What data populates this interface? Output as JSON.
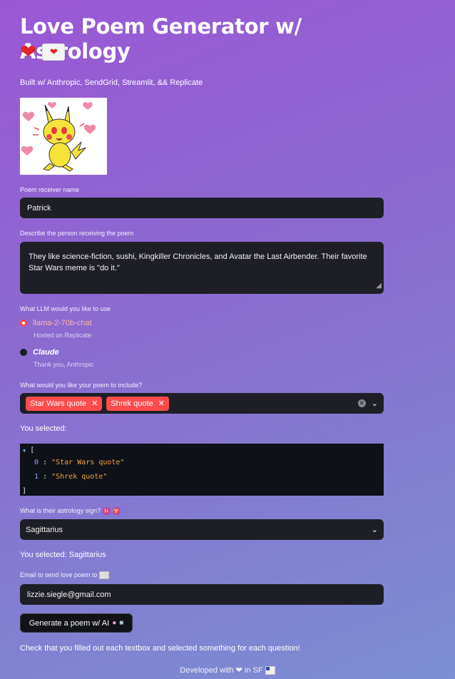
{
  "page": {
    "title": "Love Poem Generator w/ Astrology",
    "subtitle": "Built w/ Anthropic, SendGrid, Streamlit, && Replicate",
    "heart_icon": "red-heart-icon",
    "envelope_icon": "love-letter-icon"
  },
  "image": {
    "name": "pikachu-with-hearts",
    "alt": ""
  },
  "receiver": {
    "label": "Poem receiver name",
    "value": "Patrick"
  },
  "description": {
    "label": "Describe the person receiving the poem",
    "value": "They like science-fiction, sushi, Kingkiller Chronicles, and Avatar the Last Airbender. Their favorite Star Wars meme is \"do it.\""
  },
  "llm": {
    "label": "What LLM would you like to use",
    "options": [
      {
        "label": "llama-2-70b-chat",
        "caption": "Hosted on Replicate",
        "selected": true
      },
      {
        "label": "Claude",
        "caption": "Thank you, Anthropic",
        "selected": false
      }
    ]
  },
  "include": {
    "label": "What would you like your poem to include?",
    "tags": [
      "Star Wars quote",
      "Shrek quote"
    ]
  },
  "selected_include": {
    "label": "You selected:",
    "json_open": "[",
    "json_close": "]",
    "items": [
      {
        "index": "0",
        "value": "\"Star Wars quote\""
      },
      {
        "index": "1",
        "value": "\"Shrek quote\""
      }
    ]
  },
  "astrology": {
    "label": "What is their astrology sign?",
    "value": "Sagittarius",
    "selected_text": "You selected: Sagittarius",
    "sign_icons": [
      "♓",
      "♈"
    ]
  },
  "email": {
    "label": "Email to send love poem to",
    "value": "lizzie.siegle@gmail.com"
  },
  "generate_button": {
    "label": "Generate a poem w/ AI"
  },
  "instruction": "Check that you filled out each textbox and selected something for each question!",
  "footer": {
    "text": "Developed with ❤ in SF"
  },
  "colors": {
    "accent": "#ff4b4b",
    "input_bg": "#1e1f26",
    "code_bg": "#0e1117"
  }
}
